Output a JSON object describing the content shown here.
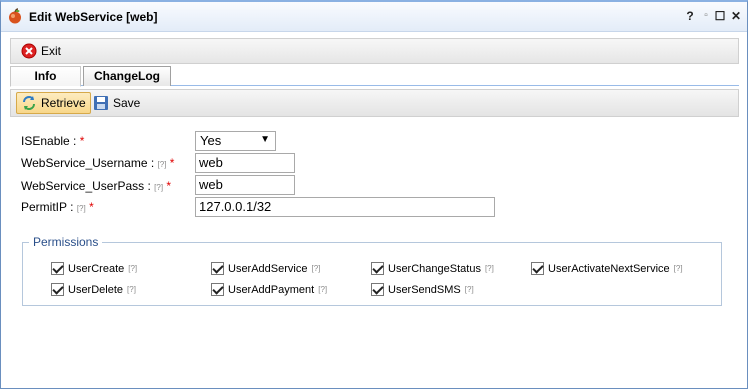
{
  "window": {
    "title": "Edit WebService [web]",
    "controls": [
      "?",
      "▫",
      "☐",
      "✕"
    ]
  },
  "toolbar": {
    "exit_label": "Exit"
  },
  "tabs": [
    {
      "label": "Info",
      "active": true
    },
    {
      "label": "ChangeLog",
      "active": false
    }
  ],
  "actions": {
    "retrieve_label": "Retrieve",
    "save_label": "Save"
  },
  "form": {
    "help_marker": "[?]",
    "required_marker": "*",
    "isenable": {
      "label": "ISEnable :",
      "value": "Yes"
    },
    "username": {
      "label": "WebService_Username :",
      "value": "web"
    },
    "userpass": {
      "label": "WebService_UserPass :",
      "value": "web"
    },
    "permitip": {
      "label": "PermitIP :",
      "value": "127.0.0.1/32"
    }
  },
  "permissions": {
    "legend": "Permissions",
    "items": [
      {
        "label": "UserCreate",
        "checked": true
      },
      {
        "label": "UserAddService",
        "checked": true
      },
      {
        "label": "UserChangeStatus",
        "checked": true
      },
      {
        "label": "UserActivateNextService",
        "checked": true
      },
      {
        "label": "UserDelete",
        "checked": true
      },
      {
        "label": "UserAddPayment",
        "checked": true
      },
      {
        "label": "UserSendSMS",
        "checked": true
      }
    ]
  },
  "colors": {
    "accent": "#2a4f8a",
    "required": "#e00000",
    "pressed": "#f8d78a"
  }
}
